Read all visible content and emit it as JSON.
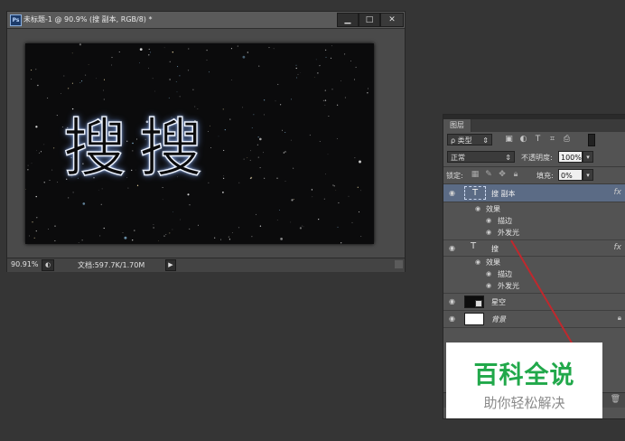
{
  "document_window": {
    "app_icon_text": "Ps",
    "title": "未标题-1 @ 90.9% (搜 副本, RGB/8) *",
    "buttons": {
      "minimize": "▁",
      "maximize": "□",
      "close": "✕"
    },
    "canvas_text": [
      "搜",
      "搜"
    ],
    "status": {
      "zoom": "90.91%",
      "doc_info": "文档:597.7K/1.70M",
      "arrow": "▶"
    }
  },
  "layers_panel": {
    "tab_label": "图层",
    "filter": {
      "kind_label": "ρ 类型",
      "icons": [
        "image-filter-icon",
        "adjustment-filter-icon",
        "type-filter-icon",
        "shape-filter-icon",
        "smartobject-filter-icon"
      ]
    },
    "blend_mode": "正常",
    "opacity_label": "不透明度:",
    "opacity_value": "100%",
    "lock_label": "锁定:",
    "fill_label": "填充:",
    "fill_value": "0%",
    "layers": [
      {
        "name": "搜 副本",
        "type": "text",
        "selected": true,
        "fx": "fx",
        "effects_label": "效果",
        "effects": [
          "描边",
          "外发光"
        ]
      },
      {
        "name": "搜",
        "type": "text",
        "selected": false,
        "fx": "fx",
        "effects_label": "效果",
        "effects": [
          "描边",
          "外发光"
        ]
      },
      {
        "name": "星空",
        "type": "pixel",
        "selected": false
      },
      {
        "name": "背景",
        "type": "background",
        "selected": false,
        "locked": true
      }
    ],
    "type_layer_glyph": "T"
  },
  "watermark": {
    "title": "百科全说",
    "subtitle": "助你轻松解决"
  },
  "colors": {
    "selected_layer": "#5b6b85",
    "watermark_green": "#21a84a",
    "annotation_line": "#c0282d"
  }
}
